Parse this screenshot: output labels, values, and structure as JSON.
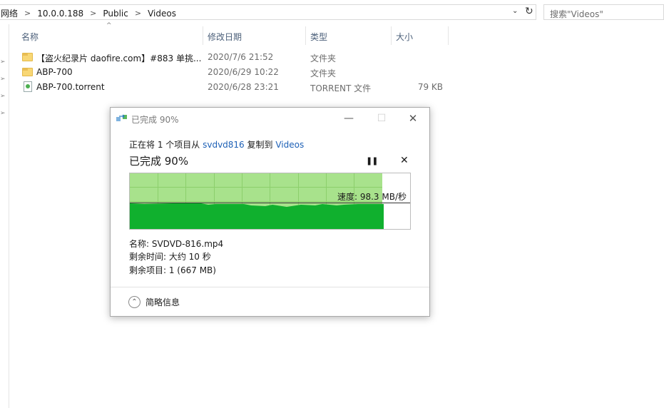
{
  "address": {
    "crumbs": [
      "网络",
      "10.0.0.188",
      "Public",
      "Videos"
    ],
    "separator": ">"
  },
  "search": {
    "placeholder": "搜索\"Videos\""
  },
  "columns": {
    "name": "名称",
    "date": "修改日期",
    "type": "类型",
    "size": "大小"
  },
  "files": [
    {
      "name": "【盗火纪录片 daofire.com】#883 单挑...",
      "date": "2020/7/6 21:52",
      "type": "文件夹",
      "size": "",
      "icon": "folder-icon"
    },
    {
      "name": "ABP-700",
      "date": "2020/6/29 10:22",
      "type": "文件夹",
      "size": "",
      "icon": "folder-icon"
    },
    {
      "name": "ABP-700.torrent",
      "date": "2020/6/28 23:21",
      "type": "TORRENT 文件",
      "size": "79 KB",
      "icon": "torrent-file-icon"
    }
  ],
  "dialog": {
    "title": "已完成 90%",
    "copy_prefix": "正在将 1 个项目从 ",
    "source": "svdvd816",
    "copy_mid": " 复制到 ",
    "destination": "Videos",
    "percent_text": "已完成 90%",
    "progress": 0.9,
    "speed_text": "速度: 98.3 MB/秒",
    "name_text": "名称: SVDVD-816.mp4",
    "time_text": "剩余时间: 大约 10 秒",
    "items_text": "剩余项目: 1 (667 MB)",
    "details_label": "简略信息",
    "colors": {
      "progress_fill": "#a8e28c",
      "speed_fill": "#10b02e",
      "link": "#1d60b6"
    }
  }
}
